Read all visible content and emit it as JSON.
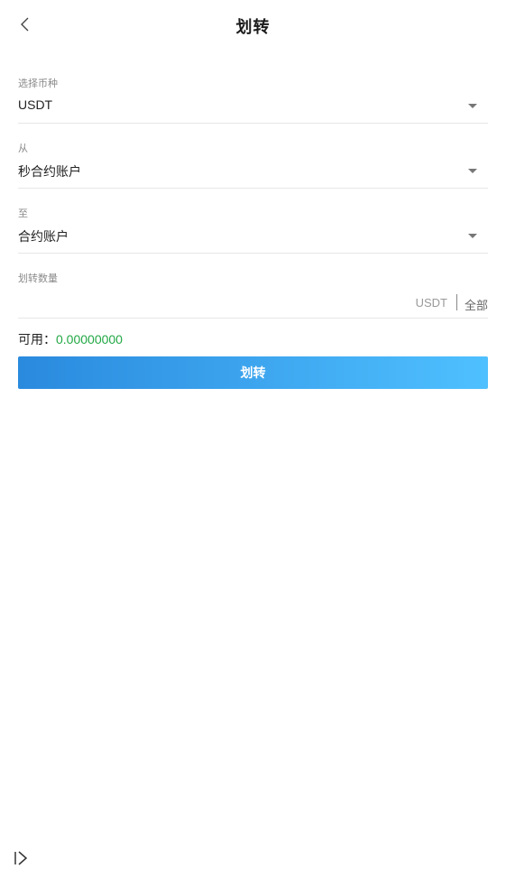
{
  "header": {
    "title": "划转"
  },
  "form": {
    "currency": {
      "label": "选择币种",
      "value": "USDT"
    },
    "from": {
      "label": "从",
      "value": "秒合约账户"
    },
    "to": {
      "label": "至",
      "value": "合约账户"
    },
    "amount": {
      "label": "划转数量",
      "placeholder": "",
      "unit": "USDT",
      "all_label": "全部"
    }
  },
  "available": {
    "label": "可用：",
    "value": "0.00000000"
  },
  "submit_label": "划转",
  "icons": {
    "back": "chevron-left-icon",
    "caret": "caret-down-icon",
    "float": "expand-panel-icon"
  },
  "colors": {
    "available_value": "#22a845",
    "button_start": "#2a8ade",
    "button_end": "#4fc0ff"
  }
}
